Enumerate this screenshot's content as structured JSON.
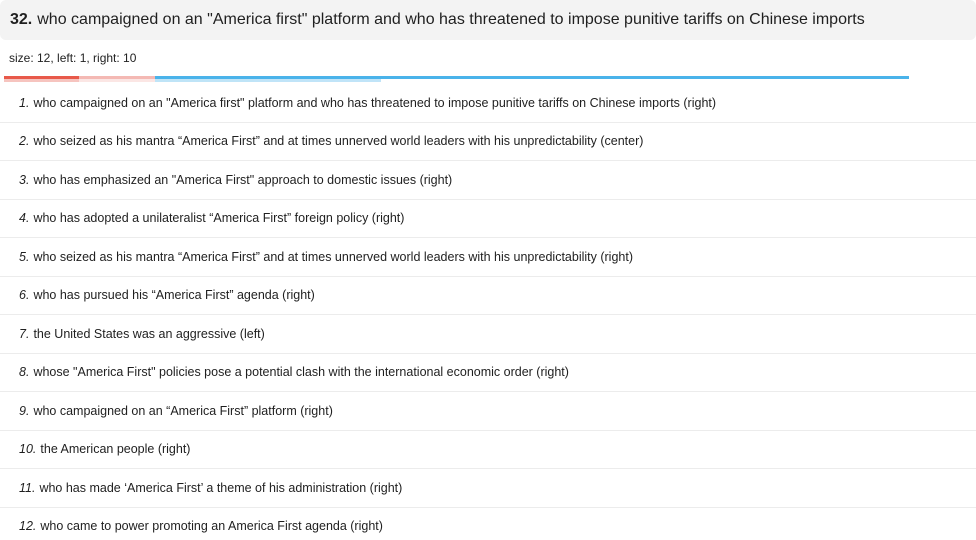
{
  "header": {
    "number": "32.",
    "title": "who campaigned on an \"America first\" platform and who has threatened to impose punitive tariffs on Chinese imports"
  },
  "meta": {
    "text": "size: 12, left: 1, right: 10"
  },
  "distribution": {
    "left_fraction": 0.0833,
    "center_fraction": 0.0833,
    "right_fraction": 0.8333,
    "colors": {
      "left": "#e8594a",
      "center": "#f4b9b4",
      "right": "#4ab3ea"
    }
  },
  "items": [
    {
      "idx": "1.",
      "text": "who campaigned on an \"America first\" platform and who has threatened to impose punitive tariffs on Chinese imports (right)"
    },
    {
      "idx": "2.",
      "text": "who seized as his mantra “America First” and at times unnerved world leaders with his unpredictability (center)"
    },
    {
      "idx": "3.",
      "text": "who has emphasized an \"America First\" approach to domestic issues (right)"
    },
    {
      "idx": "4.",
      "text": "who has adopted a unilateralist “America First” foreign policy (right)"
    },
    {
      "idx": "5.",
      "text": "who seized as his mantra “America First” and at times unnerved world leaders with his unpredictability (right)"
    },
    {
      "idx": "6.",
      "text": "who has pursued his “America First” agenda (right)"
    },
    {
      "idx": "7.",
      "text": "the United States was an aggressive (left)"
    },
    {
      "idx": "8.",
      "text": "whose \"America First\" policies pose a potential clash with the international economic order (right)"
    },
    {
      "idx": "9.",
      "text": "who campaigned on an “America First” platform (right)"
    },
    {
      "idx": "10.",
      "text": "the American people (right)"
    },
    {
      "idx": "11.",
      "text": "who has made ‘America First’ a theme of his administration (right)"
    },
    {
      "idx": "12.",
      "text": "who came to power promoting an America First agenda (right)"
    }
  ]
}
